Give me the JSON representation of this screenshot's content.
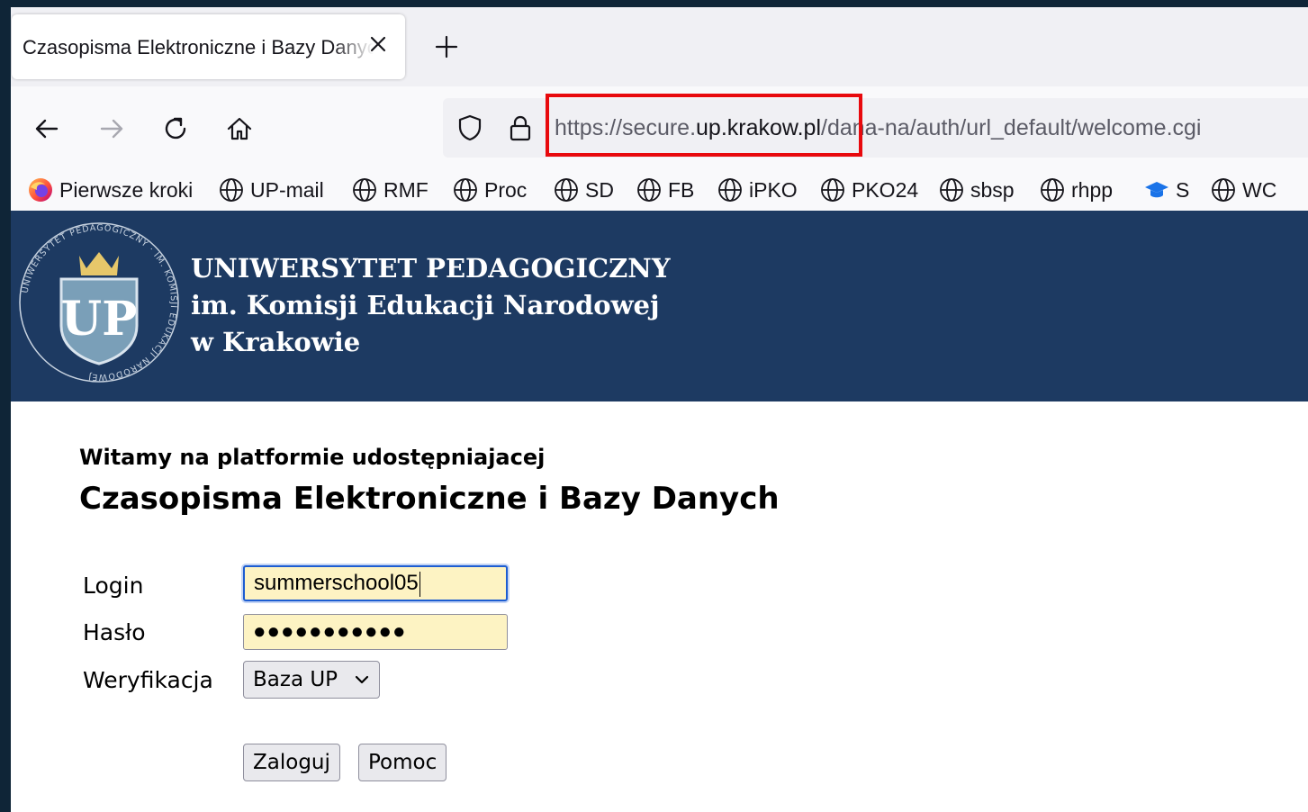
{
  "browser": {
    "tab": {
      "title": "Czasopisma Elektroniczne i Bazy Danych",
      "close_icon": "close-icon"
    },
    "new_tab_icon": "plus-icon",
    "url": {
      "scheme": "https://",
      "subdomain": "secure.",
      "domain": "up.krakow.pl",
      "path": "/dana-na/auth/url_default/welcome.cgi"
    },
    "highlight_color": "#e8090d",
    "bookmarks": [
      {
        "label": "Pierwsze kroki",
        "icon": "firefox-icon"
      },
      {
        "label": "UP-mail",
        "icon": "globe-icon"
      },
      {
        "label": "RMF",
        "icon": "globe-icon"
      },
      {
        "label": "Proc",
        "icon": "globe-icon"
      },
      {
        "label": "SD",
        "icon": "globe-icon"
      },
      {
        "label": "FB",
        "icon": "globe-icon"
      },
      {
        "label": "iPKO",
        "icon": "globe-icon"
      },
      {
        "label": "PKO24",
        "icon": "globe-icon"
      },
      {
        "label": "sbsp",
        "icon": "globe-icon"
      },
      {
        "label": "rhpp",
        "icon": "globe-icon"
      },
      {
        "label": "S",
        "icon": "graduation-cap-icon"
      },
      {
        "label": "WC",
        "icon": "globe-icon"
      }
    ]
  },
  "header": {
    "bg_color": "#1d3a62",
    "logo": {
      "ring_text": "UNIWERSYTET PEDAGOGICZNY · IM. KOMISJI EDUKACJI NARODOWEJ",
      "shield_text": "UP"
    },
    "line1": "UNIWERSYTET PEDAGOGICZNY",
    "line2": "im. Komisji Edukacji Narodowej",
    "line3": "w Krakowie"
  },
  "page": {
    "welcome": "Witamy na platformie udostępniajacej",
    "title": "Czasopisma Elektroniczne i Bazy Danych",
    "login_label": "Login",
    "login_value": "summerschool05",
    "password_label": "Hasło",
    "password_mask": "●●●●●●●●●●●",
    "verify_label": "Weryfikacja",
    "verify_value": "Baza UP",
    "login_button": "Zaloguj",
    "help_button": "Pomoc"
  }
}
